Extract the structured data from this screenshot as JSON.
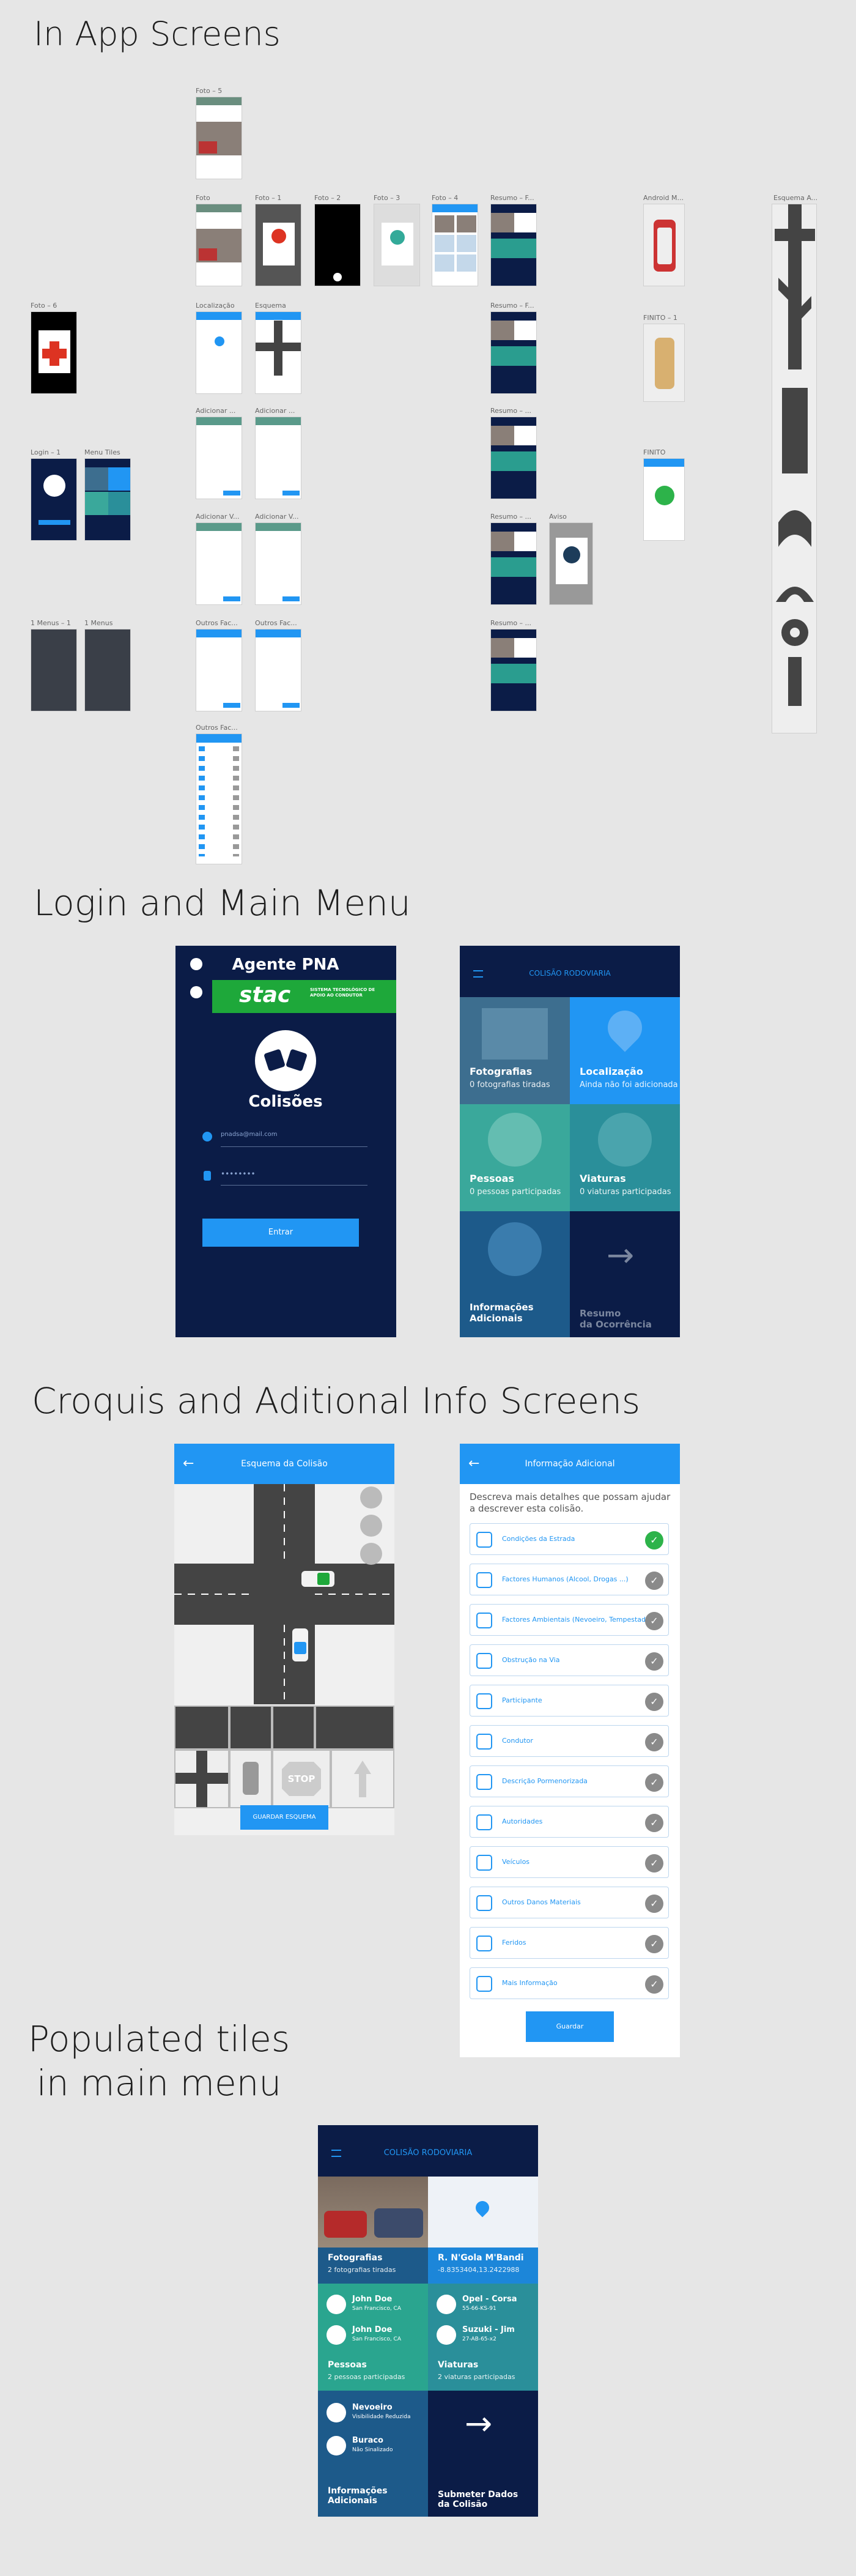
{
  "sections": {
    "in_app": "In App Screens",
    "login_main": "Login and Main Menu",
    "croquis": "Croquis and Aditional Info Screens",
    "populated": "Populated tiles\nin main menu"
  },
  "thumbs": {
    "foto5": "Foto – 5",
    "foto": "Foto",
    "foto1": "Foto – 1",
    "foto2": "Foto – 2",
    "foto3": "Foto – 3",
    "foto4": "Foto – 4",
    "resumo_f1": "Resumo – F...",
    "android": "Android M...",
    "esquema_a": "Esquema A...",
    "foto6": "Foto – 6",
    "localizacao": "Localização",
    "esquema": "Esquema",
    "resumo_f2": "Resumo – F...",
    "finito1": "FINITO – 1",
    "login1": "Login – 1",
    "menu_tiles": "Menu Tiles",
    "adicionar1": "Adicionar ...",
    "adicionar2": "Adicionar ...",
    "resumo3": "Resumo – ...",
    "finito": "FINITO",
    "adicionar_v1": "Adicionar V...",
    "adicionar_v2": "Adicionar V...",
    "resumo4": "Resumo – ...",
    "aviso": "Aviso",
    "menus1": "1 Menus – 1",
    "menus": "1 Menus",
    "outros1": "Outros Fac...",
    "outros2": "Outros Fac...",
    "resumo5": "Resumo – ...",
    "outros3": "Outros Fac..."
  },
  "login": {
    "title": "Agente PNA",
    "brand": "stac",
    "brand_sub": "SISTEMA TECNOLÓGICO DE APOIO AO CONDUTOR",
    "logo_text": "Colisões",
    "email": "pnadsa@mail.com",
    "password": "••••••••",
    "button": "Entrar"
  },
  "main_menu": {
    "title": "COLISÃO RODOVIARIA",
    "tiles": [
      {
        "title": "Fotografias",
        "sub": "0 fotografias tiradas"
      },
      {
        "title": "Localização",
        "sub": "Ainda não foi adicionada"
      },
      {
        "title": "Pessoas",
        "sub": "0 pessoas participadas"
      },
      {
        "title": "Viaturas",
        "sub": "0 viaturas participadas"
      },
      {
        "title": "Informações Adicionais",
        "sub": ""
      },
      {
        "title": "Resumo\nda Ocorrência",
        "sub": ""
      }
    ]
  },
  "esquema": {
    "title": "Esquema da Colisão",
    "save": "GUARDAR ESQUEMA",
    "stop": "STOP"
  },
  "info": {
    "title": "Informação Adicional",
    "intro": "Descreva mais detalhes que possam ajudar a descrever esta colisão.",
    "items": [
      "Condições da Estrada",
      "Factores Humanos (Alcool, Drogas ...)",
      "Factores Ambientais (Nevoeiro, Tempestade ...)",
      "Obstrução na Via",
      "Participante",
      "Condutor",
      "Descrição Pormenorizada",
      "Autoridades",
      "Veículos",
      "Outros Danos Materiais",
      "Feridos",
      "Mais Informação"
    ],
    "button": "Guardar"
  },
  "populated": {
    "title": "COLISÃO RODOVIARIA",
    "photos_title": "Fotografias",
    "photos_sub": "2 fotografias tiradas",
    "loc_title": "R. N'Gola M'Bandi",
    "loc_sub": "-8.8353404,13.2422988",
    "people": [
      {
        "name": "John Doe",
        "place": "San Francisco, CA"
      },
      {
        "name": "John Doe",
        "place": "San Francisco, CA"
      }
    ],
    "cars": [
      {
        "name": "Opel - Corsa",
        "plate": "55-66-KS-91"
      },
      {
        "name": "Suzuki - Jim",
        "plate": "27-AB-65-x2"
      }
    ],
    "people_title": "Pessoas",
    "people_sub": "2 pessoas participadas",
    "cars_title": "Viaturas",
    "cars_sub": "2 viaturas participadas",
    "extras": [
      {
        "name": "Nevoeiro",
        "sub": "Visibilidade Reduzida"
      },
      {
        "name": "Buraco",
        "sub": "Não Sinalizado"
      }
    ],
    "info_title": "Informações Adicionais",
    "submit_title": "Submeter Dados\nda Colisão"
  }
}
